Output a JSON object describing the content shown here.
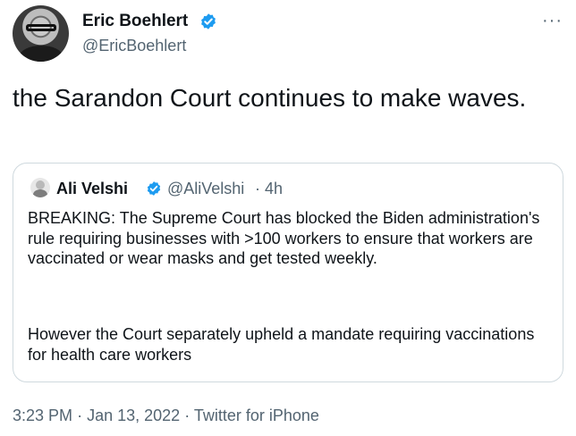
{
  "author": {
    "name": "Eric Boehlert",
    "handle": "@EricBoehlert",
    "verified": true,
    "avatar_icon": "avatar-photo"
  },
  "more_label": "···",
  "tweet_text": "the Sarandon Court continues to make waves.",
  "quoted": {
    "name": "Ali Velshi",
    "handle": "@AliVelshi",
    "separator": "·",
    "time": "4h",
    "verified": true,
    "paragraphs": [
      "BREAKING: The Supreme Court has blocked the Biden administration's rule requiring businesses with >100 workers to ensure that workers are vaccinated or wear masks and get tested weekly.",
      "However the Court separately upheld a mandate requiring vaccinations for health care workers"
    ]
  },
  "meta": {
    "time": "3:23 PM",
    "date": "Jan 13, 2022",
    "source": "Twitter for iPhone",
    "separator": "·"
  },
  "colors": {
    "text": "#0f1419",
    "secondary": "#536471",
    "verified": "#1d9bf0",
    "border": "#cfd9de"
  }
}
